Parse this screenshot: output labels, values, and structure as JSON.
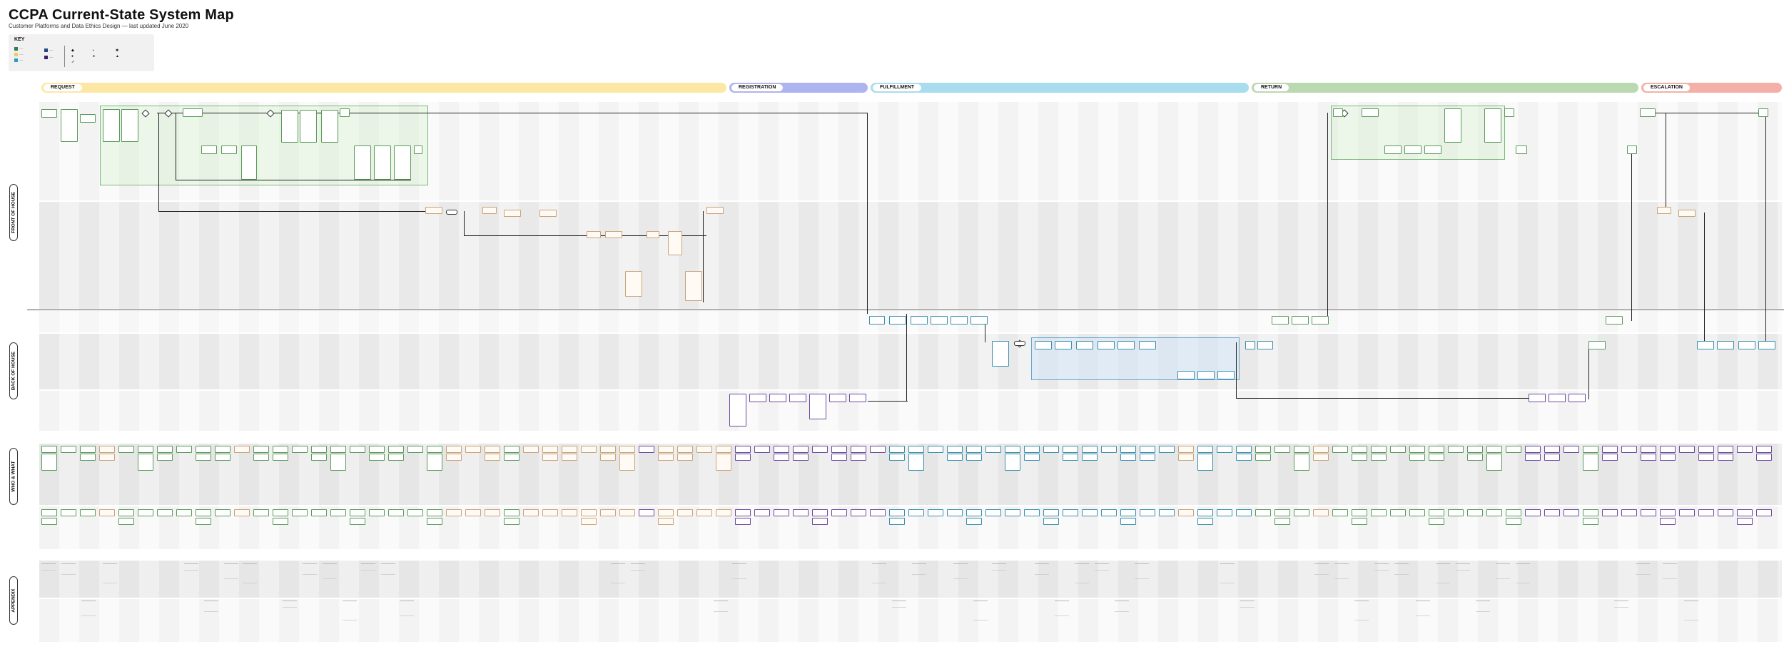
{
  "title": "CCPA Current-State System Map",
  "subtitle": "Customer Platforms and Data Ethics Design — last updated June 2020",
  "key": {
    "title": "KEY",
    "swatches": [
      {
        "color": "#2e7d4f"
      },
      {
        "color": "#f2c66a"
      },
      {
        "color": "#1f9fc4"
      },
      {
        "color": "#214a7a"
      },
      {
        "color": "#3f1f6b"
      }
    ],
    "symbols": [
      {
        "name": "diamond-icon"
      },
      {
        "name": "circle-icon"
      },
      {
        "name": "arrow-icon"
      },
      {
        "name": "document-icon"
      },
      {
        "name": "person-icon"
      },
      {
        "name": "gear-icon"
      }
    ]
  },
  "phases": [
    {
      "label": "REQUEST",
      "color": "#fde7a4"
    },
    {
      "label": "REGISTRATION",
      "color": "#aeb4ef"
    },
    {
      "label": "FULFILLMENT",
      "color": "#a9dcef"
    },
    {
      "label": "RETURN",
      "color": "#bad9b0"
    },
    {
      "label": "ESCALATION",
      "color": "#f4b0a8"
    }
  ],
  "sections": [
    {
      "label": "FRONT OF HOUSE"
    },
    {
      "label": "BACK OF HOUSE"
    },
    {
      "label": "WHO & WHAT"
    },
    {
      "label": "APPENDIX"
    }
  ]
}
